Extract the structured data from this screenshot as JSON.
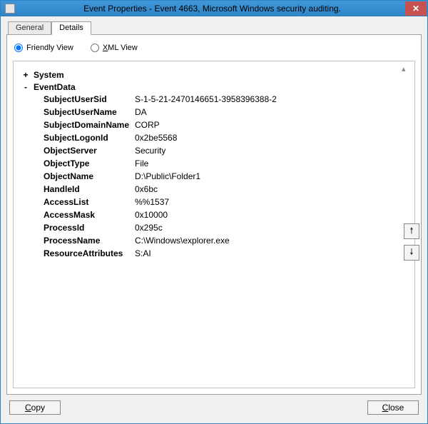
{
  "window": {
    "title": "Event Properties - Event 4663, Microsoft Windows security auditing."
  },
  "tabs": {
    "general": "General",
    "details": "Details"
  },
  "views": {
    "friendly": "Friendly View",
    "xml": "XML View"
  },
  "tree": {
    "system": "System",
    "eventdata": "EventData"
  },
  "fields": {
    "SubjectUserSid": {
      "name": "SubjectUserSid",
      "value": "S-1-5-21-2470146651-3958396388-2"
    },
    "SubjectUserName": {
      "name": "SubjectUserName",
      "value": "DA"
    },
    "SubjectDomainName": {
      "name": "SubjectDomainName",
      "value": "CORP"
    },
    "SubjectLogonId": {
      "name": "SubjectLogonId",
      "value": "0x2be5568"
    },
    "ObjectServer": {
      "name": "ObjectServer",
      "value": "Security"
    },
    "ObjectType": {
      "name": "ObjectType",
      "value": "File"
    },
    "ObjectName": {
      "name": "ObjectName",
      "value": "D:\\Public\\Folder1"
    },
    "HandleId": {
      "name": "HandleId",
      "value": "0x6bc"
    },
    "AccessList": {
      "name": "AccessList",
      "value": "%%1537"
    },
    "AccessMask": {
      "name": "AccessMask",
      "value": "0x10000"
    },
    "ProcessId": {
      "name": "ProcessId",
      "value": "0x295c"
    },
    "ProcessName": {
      "name": "ProcessName",
      "value": "C:\\Windows\\explorer.exe"
    },
    "ResourceAttributes": {
      "name": "ResourceAttributes",
      "value": "S:AI"
    }
  },
  "buttons": {
    "copy": "Copy",
    "close": "Close"
  }
}
